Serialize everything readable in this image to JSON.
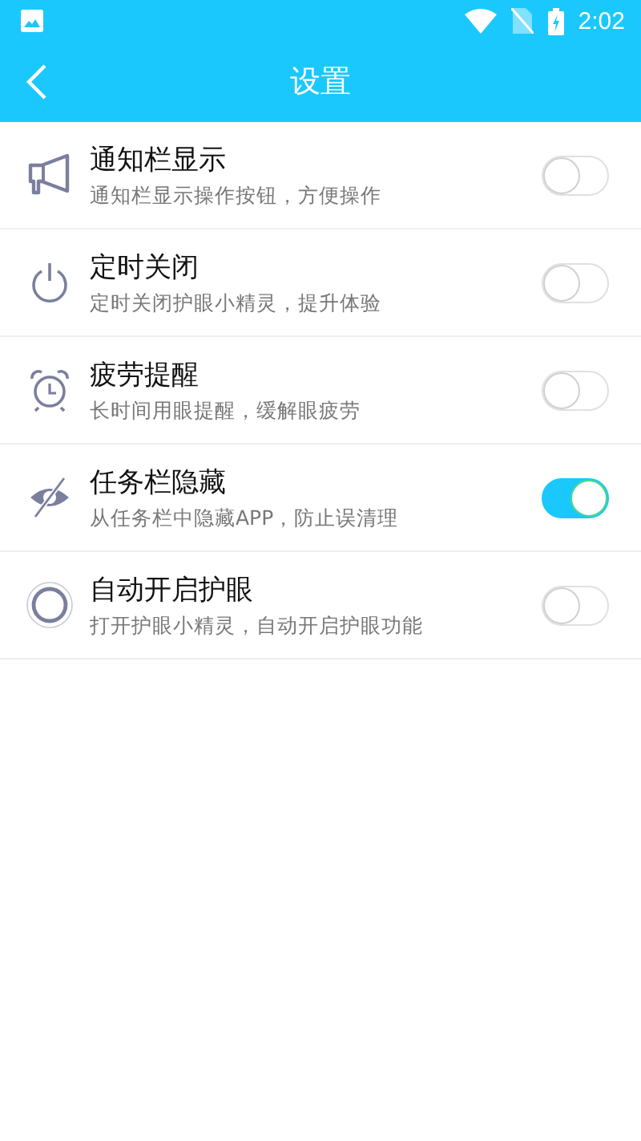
{
  "status_bar": {
    "time": "2:02"
  },
  "toolbar": {
    "title": "设置"
  },
  "settings": [
    {
      "title": "通知栏显示",
      "subtitle": "通知栏显示操作按钮，方便操作",
      "on": false
    },
    {
      "title": "定时关闭",
      "subtitle": "定时关闭护眼小精灵，提升体验",
      "on": false
    },
    {
      "title": "疲劳提醒",
      "subtitle": "长时间用眼提醒，缓解眼疲劳",
      "on": false
    },
    {
      "title": "任务栏隐藏",
      "subtitle": "从任务栏中隐藏APP，防止误清理",
      "on": true
    },
    {
      "title": "自动开启护眼",
      "subtitle": "打开护眼小精灵，自动开启护眼功能",
      "on": false
    }
  ]
}
